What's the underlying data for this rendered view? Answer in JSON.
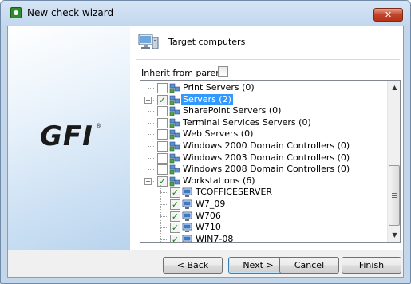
{
  "window": {
    "title": "New check wizard",
    "close_label": "✕"
  },
  "sidebar": {
    "logo_text": "GFI",
    "logo_mark": "®"
  },
  "header": {
    "icon": "computer-monitor-icon",
    "title": "Target computers"
  },
  "inherit": {
    "label": "Inherit from parent:",
    "checked": false
  },
  "tree": {
    "items": [
      {
        "label": "Print Servers (0)",
        "checked": false,
        "expandable": false,
        "level": 1
      },
      {
        "label": "Servers (2)",
        "checked": true,
        "expandable": true,
        "expanded": false,
        "selected": true,
        "level": 1
      },
      {
        "label": "SharePoint Servers (0)",
        "checked": false,
        "expandable": false,
        "level": 1
      },
      {
        "label": "Terminal Services Servers (0)",
        "checked": false,
        "expandable": false,
        "level": 1
      },
      {
        "label": "Web Servers (0)",
        "checked": false,
        "expandable": false,
        "level": 1
      },
      {
        "label": "Windows 2000 Domain Controllers (0)",
        "checked": false,
        "expandable": false,
        "level": 1
      },
      {
        "label": "Windows 2003 Domain Controllers (0)",
        "checked": false,
        "expandable": false,
        "level": 1
      },
      {
        "label": "Windows 2008 Domain Controllers (0)",
        "checked": false,
        "expandable": false,
        "level": 1
      },
      {
        "label": "Workstations (6)",
        "checked": true,
        "expandable": true,
        "expanded": true,
        "level": 1
      },
      {
        "label": "TCOFFICESERVER",
        "checked": true,
        "expandable": false,
        "level": 2
      },
      {
        "label": "W7_09",
        "checked": true,
        "expandable": false,
        "level": 2
      },
      {
        "label": "W706",
        "checked": true,
        "expandable": false,
        "level": 2
      },
      {
        "label": "W710",
        "checked": true,
        "expandable": false,
        "level": 2
      },
      {
        "label": "WIN7-08",
        "checked": true,
        "expandable": false,
        "level": 2
      }
    ]
  },
  "buttons": {
    "back": "< Back",
    "next": "Next >",
    "cancel": "Cancel",
    "finish": "Finish"
  },
  "colors": {
    "selection": "#3399ff",
    "check_mark": "#1a7f1a",
    "close_button": "#c2432a"
  }
}
